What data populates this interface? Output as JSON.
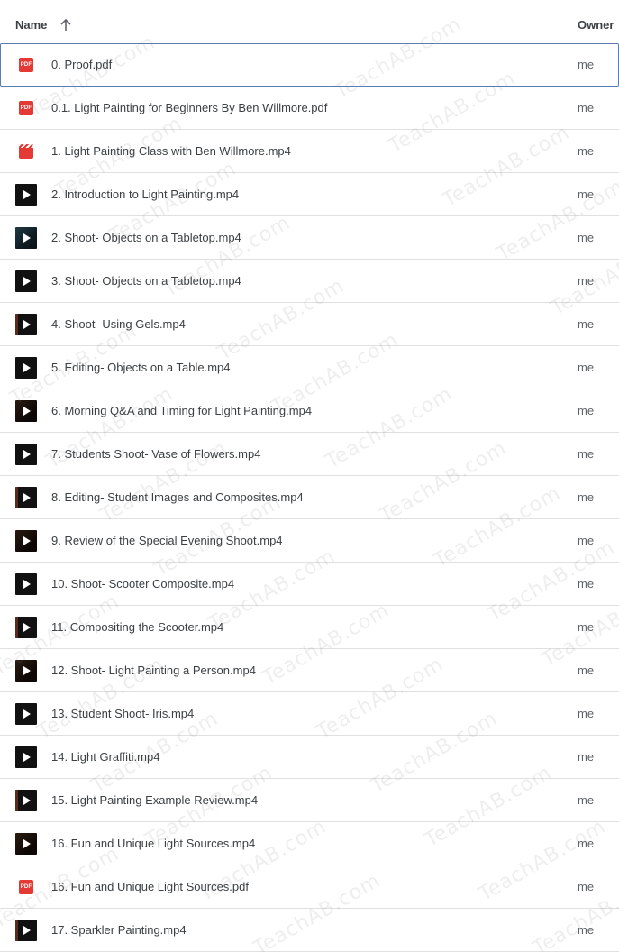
{
  "header": {
    "name_label": "Name",
    "owner_label": "Owner",
    "sort_direction": "ascending"
  },
  "watermark": "TeachAB.com",
  "files": [
    {
      "name": "0. Proof.pdf",
      "owner": "me",
      "type": "pdf",
      "selected": true
    },
    {
      "name": "0.1. Light Painting for Beginners By Ben Willmore.pdf",
      "owner": "me",
      "type": "pdf"
    },
    {
      "name": "1. Light Painting Class with Ben Willmore.mp4",
      "owner": "me",
      "type": "video-generic"
    },
    {
      "name": "2. Introduction to Light Painting.mp4",
      "owner": "me",
      "type": "video"
    },
    {
      "name": "2. Shoot- Objects on a Tabletop.mp4",
      "owner": "me",
      "type": "video",
      "thumb": "teal"
    },
    {
      "name": "3. Shoot- Objects on a Tabletop.mp4",
      "owner": "me",
      "type": "video"
    },
    {
      "name": "4. Shoot- Using Gels.mp4",
      "owner": "me",
      "type": "video",
      "thumb": "edge"
    },
    {
      "name": "5. Editing- Objects on a Table.mp4",
      "owner": "me",
      "type": "video"
    },
    {
      "name": "6. Morning Q&A and Timing for Light Painting.mp4",
      "owner": "me",
      "type": "video",
      "thumb": "warm"
    },
    {
      "name": "7. Students Shoot- Vase of Flowers.mp4",
      "owner": "me",
      "type": "video"
    },
    {
      "name": "8. Editing- Student Images and Composites.mp4",
      "owner": "me",
      "type": "video",
      "thumb": "edge"
    },
    {
      "name": "9. Review of the Special Evening Shoot.mp4",
      "owner": "me",
      "type": "video",
      "thumb": "warm"
    },
    {
      "name": "10. Shoot- Scooter Composite.mp4",
      "owner": "me",
      "type": "video"
    },
    {
      "name": "11. Compositing the Scooter.mp4",
      "owner": "me",
      "type": "video",
      "thumb": "edge"
    },
    {
      "name": "12. Shoot- Light Painting a Person.mp4",
      "owner": "me",
      "type": "video",
      "thumb": "warm"
    },
    {
      "name": "13. Student Shoot- Iris.mp4",
      "owner": "me",
      "type": "video"
    },
    {
      "name": "14. Light Graffiti.mp4",
      "owner": "me",
      "type": "video"
    },
    {
      "name": "15. Light Painting Example Review.mp4",
      "owner": "me",
      "type": "video",
      "thumb": "edge"
    },
    {
      "name": "16. Fun and Unique Light Sources.mp4",
      "owner": "me",
      "type": "video",
      "thumb": "warm"
    },
    {
      "name": "16. Fun and Unique Light Sources.pdf",
      "owner": "me",
      "type": "pdf"
    },
    {
      "name": "17. Sparkler Painting.mp4",
      "owner": "me",
      "type": "video",
      "thumb": "edge"
    }
  ],
  "icons": {
    "pdf": "pdf-file-icon",
    "video": "video-thumbnail-icon",
    "video-generic": "video-file-icon",
    "sort": "arrow-up-icon"
  },
  "pdf_badge_text": "PDF"
}
